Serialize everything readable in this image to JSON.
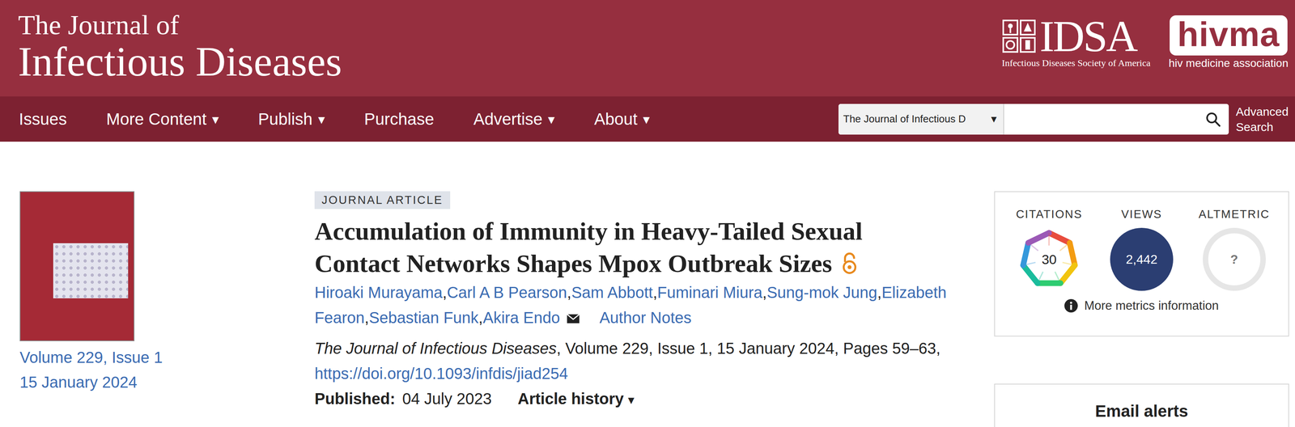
{
  "header": {
    "title_line1": "The Journal of",
    "title_line2": "Infectious Diseases",
    "idsa": {
      "name": "IDSA",
      "subtitle": "Infectious Diseases Society of America"
    },
    "hivma": {
      "name": "hivma",
      "subtitle": "hiv medicine association"
    }
  },
  "nav": [
    {
      "label": "Issues"
    },
    {
      "label": "More Content",
      "caret": "▾"
    },
    {
      "label": "Publish",
      "caret": "▾"
    },
    {
      "label": "Purchase"
    },
    {
      "label": "Advertise",
      "caret": "▾"
    },
    {
      "label": "About",
      "caret": "▾"
    }
  ],
  "search": {
    "scope": "The Journal of Infectious D",
    "scope_caret": "▼",
    "advanced": "Advanced Search"
  },
  "issue": {
    "volume": "Volume 229, Issue 1",
    "date": "15 January 2024"
  },
  "article": {
    "type": "JOURNAL ARTICLE",
    "title": "Accumulation of Immunity in Heavy-Tailed Sexual Contact Networks Shapes Mpox Outbreak Sizes",
    "open_access": true,
    "authors": [
      {
        "name": "Hiroaki Murayama",
        "corresponding": false
      },
      {
        "name": "Carl A B Pearson",
        "corresponding": false
      },
      {
        "name": "Sam Abbott",
        "corresponding": false
      },
      {
        "name": "Fuminari Miura",
        "corresponding": false
      },
      {
        "name": "Sung-mok Jung",
        "corresponding": false
      },
      {
        "name": "Elizabeth Fearon",
        "corresponding": false
      },
      {
        "name": "Sebastian Funk",
        "corresponding": false
      },
      {
        "name": "Akira Endo",
        "corresponding": true
      }
    ],
    "author_separator": ",",
    "author_notes": "Author Notes",
    "journal": "The Journal of Infectious Diseases",
    "citation": ", Volume 229, Issue 1, 15 January 2024, Pages 59–63,",
    "doi": "https://doi.org/10.1093/infdis/jiad254",
    "published_label": "Published:",
    "published_date": "04 July 2023",
    "history": "Article history",
    "history_caret": "▾"
  },
  "metrics": {
    "items": [
      {
        "label": "CITATIONS",
        "value": "30",
        "kind": "dimensions"
      },
      {
        "label": "VIEWS",
        "value": "2,442",
        "kind": "views"
      },
      {
        "label": "ALTMETRIC",
        "value": "?",
        "kind": "altmetric"
      }
    ],
    "more": "More metrics information"
  },
  "email_alerts": {
    "title": "Email alerts"
  }
}
